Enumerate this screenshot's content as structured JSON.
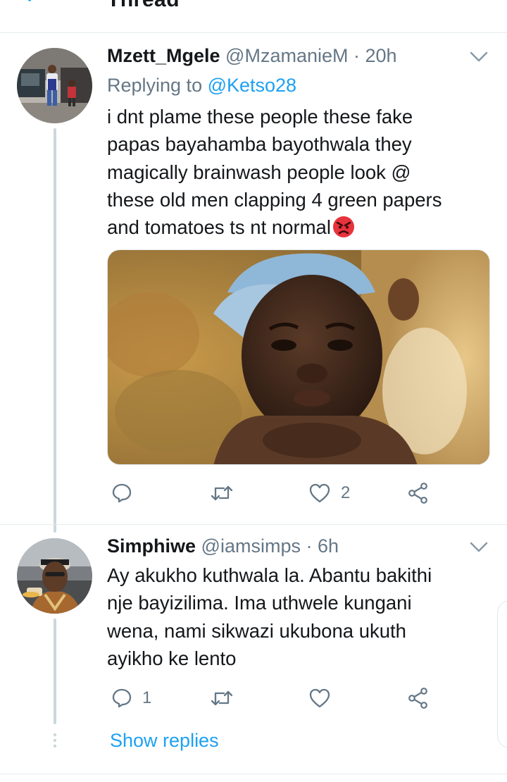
{
  "header": {
    "title": "Thread"
  },
  "tweets": [
    {
      "display_name": "Mzett_Mgele",
      "handle": "@MzamanieM",
      "time": "· 20h",
      "replying_prefix": "Replying to ",
      "replying_to": "@Ketso28",
      "lines": [
        "i dnt plame these people these fake",
        "papas bayahamba bayothwala they",
        "magically  brainwash  people look @",
        "these old men clapping 4 green papers",
        "and tomatoes  ts nt normal"
      ],
      "emoji": "angry-face",
      "actions": {
        "replies": "",
        "retweets": "",
        "likes": "2"
      }
    },
    {
      "display_name": "Simphiwe",
      "handle": "@iamsimps",
      "time": "· 6h",
      "lines": [
        "Ay akukho kuthwala la. Abantu bakithi",
        "nje bayizilima. Ima uthwele kungani",
        "wena, nami sikwazi ukubona ukuth",
        "ayikho ke lento"
      ],
      "actions": {
        "replies": "1",
        "retweets": "",
        "likes": ""
      }
    }
  ],
  "show_replies": "Show replies",
  "colors": {
    "link": "#1da1f2",
    "muted": "#657786",
    "text": "#14171a",
    "thread_line": "#ccd6dd"
  }
}
